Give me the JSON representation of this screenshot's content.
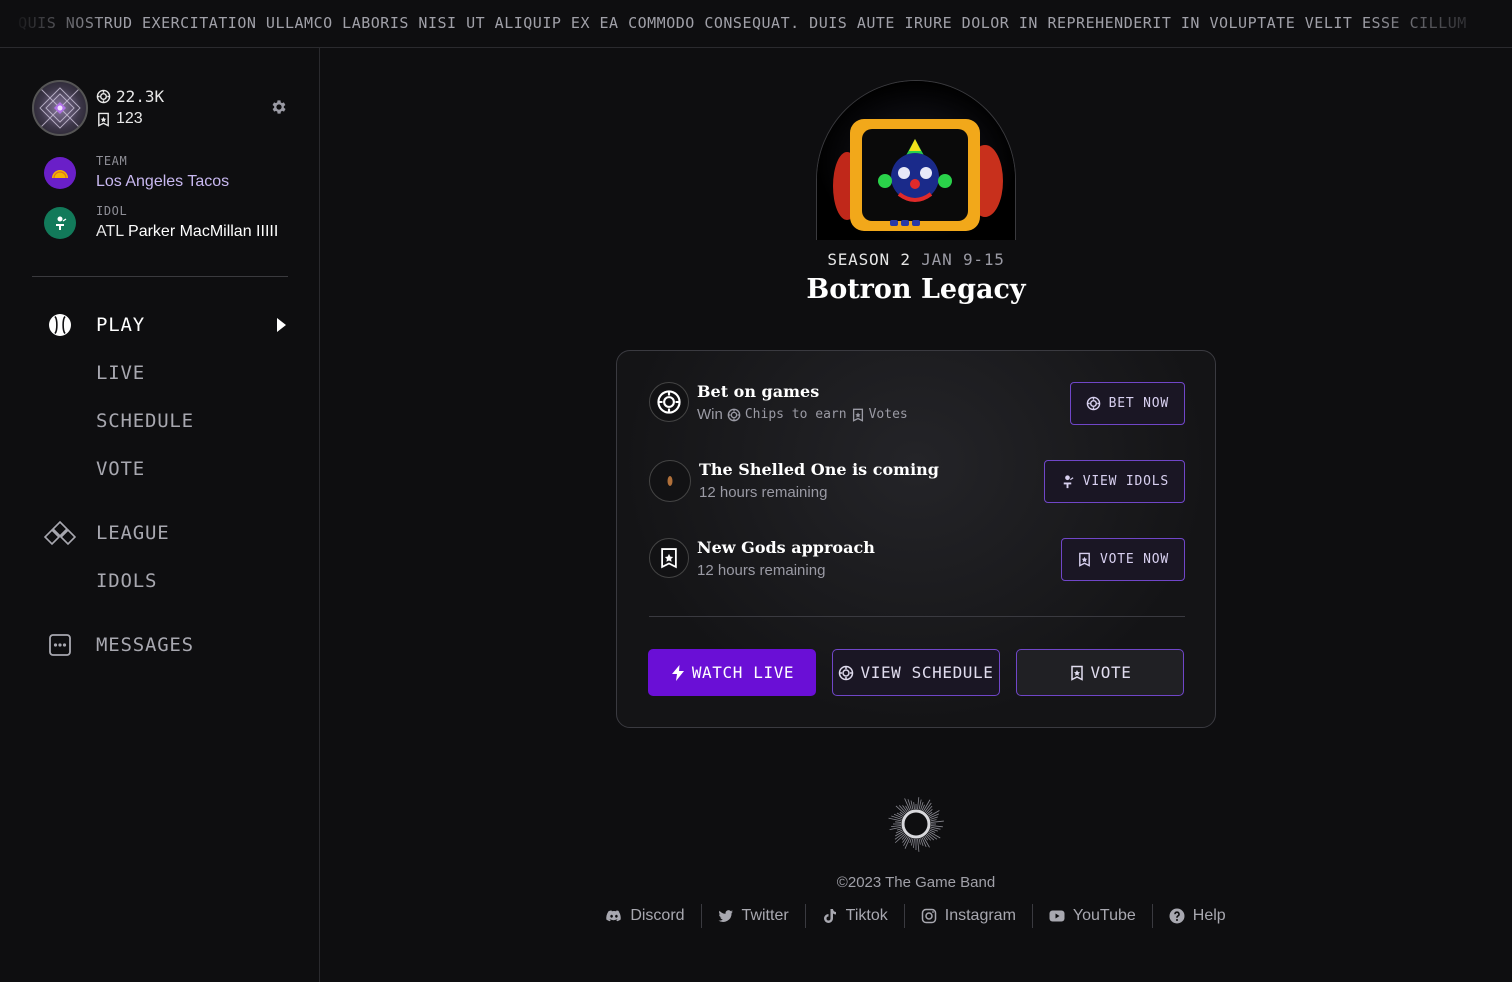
{
  "ticker": {
    "text": "AM, QUIS NOSTRUD EXERCITATION ULLAMCO LABORIS NISI UT ALIQUIP EX EA COMMODO CONSEQUAT. DUIS AUTE IRURE DOLOR IN REPREHENDERIT IN VOLUPTATE VELIT ESSE CILLUM"
  },
  "profile": {
    "chips": "22.3K",
    "votes": "123"
  },
  "favorites": {
    "team_label": "TEAM",
    "team_value": "Los Angeles Tacos",
    "idol_label": "IDOL",
    "idol_team": "ATL",
    "idol_value": "Parker MacMillan IIIII"
  },
  "nav": {
    "play": "PLAY",
    "live": "LIVE",
    "schedule": "SCHEDULE",
    "vote": "VOTE",
    "league": "LEAGUE",
    "idols": "IDOLS",
    "messages": "MESSAGES"
  },
  "season": {
    "label": "SEASON 2",
    "dates": "JAN 9-15",
    "title": "Botron Legacy"
  },
  "card": {
    "rows": [
      {
        "title": "Bet on games",
        "sub_prefix": "Win",
        "sub_chips": "Chips to earn",
        "sub_votes": "Votes",
        "button": "BET NOW"
      },
      {
        "title": "The Shelled One is coming",
        "sub": "12 hours remaining",
        "button": "VIEW IDOLS"
      },
      {
        "title": "New Gods approach",
        "sub": "12 hours remaining",
        "button": "VOTE NOW"
      }
    ],
    "actions": {
      "watch": "WATCH LIVE",
      "schedule": "VIEW SCHEDULE",
      "vote": "VOTE"
    }
  },
  "footer": {
    "copyright": "©2023 The Game Band",
    "links": [
      "Discord",
      "Twitter",
      "Tiktok",
      "Instagram",
      "YouTube",
      "Help"
    ]
  },
  "colors": {
    "accent": "#6a0fd6",
    "accent_border": "#7046c8",
    "team": "#6a1fc8",
    "idol": "#127a5a",
    "background": "#0e0e10"
  }
}
